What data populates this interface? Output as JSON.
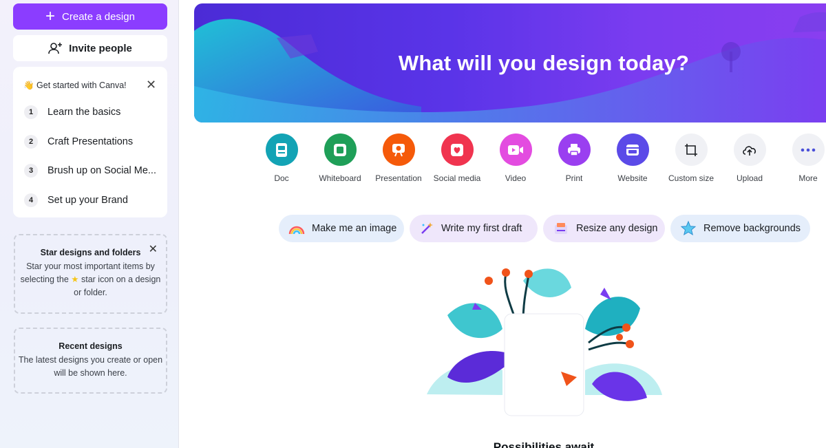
{
  "sidebar": {
    "create_label": "Create a design",
    "invite_label": "Invite people",
    "get_started": {
      "title": "👋 Get started with Canva!",
      "steps": [
        {
          "num": "1",
          "label": "Learn the basics"
        },
        {
          "num": "2",
          "label": "Craft Presentations"
        },
        {
          "num": "3",
          "label": "Brush up on Social Me..."
        },
        {
          "num": "4",
          "label": "Set up your Brand"
        }
      ]
    },
    "star_card": {
      "title": "Star designs and folders",
      "text_1": "Star your most important items by",
      "text_2a": "selecting the",
      "text_2b": "star icon on a design",
      "text_3": "or folder."
    },
    "recent_card": {
      "title": "Recent designs",
      "text_1": "The latest designs you create or open",
      "text_2": "will be shown here."
    }
  },
  "hero": {
    "title": "What will you design today?"
  },
  "design_types": [
    {
      "label": "Doc",
      "icon": "doc-icon",
      "color": "#13a3b5"
    },
    {
      "label": "Whiteboard",
      "icon": "whiteboard-icon",
      "color": "#1f9f58"
    },
    {
      "label": "Presentation",
      "icon": "presentation-icon",
      "color": "#f55a0a"
    },
    {
      "label": "Social media",
      "icon": "heart-icon",
      "color": "#f0344f"
    },
    {
      "label": "Video",
      "icon": "video-icon",
      "color": "#e34ce0"
    },
    {
      "label": "Print",
      "icon": "printer-icon",
      "color": "#9a3ff0"
    },
    {
      "label": "Website",
      "icon": "website-icon",
      "color": "#5b4ae8"
    },
    {
      "label": "Custom size",
      "icon": "crop-icon",
      "color": "#f0f1f5"
    },
    {
      "label": "Upload",
      "icon": "upload-cloud-icon",
      "color": "#f0f1f5"
    },
    {
      "label": "More",
      "icon": "more-dots-icon",
      "color": "#f0f1f5"
    }
  ],
  "ai_prompts": [
    {
      "label": "Make me an image",
      "icon": "rainbow-icon"
    },
    {
      "label": "Write my first draft",
      "icon": "magic-wand-icon"
    },
    {
      "label": "Resize any design",
      "icon": "resize-icon"
    },
    {
      "label": "Remove backgrounds",
      "icon": "star-icon"
    }
  ],
  "empty_state": {
    "title": "Possibilities await"
  }
}
